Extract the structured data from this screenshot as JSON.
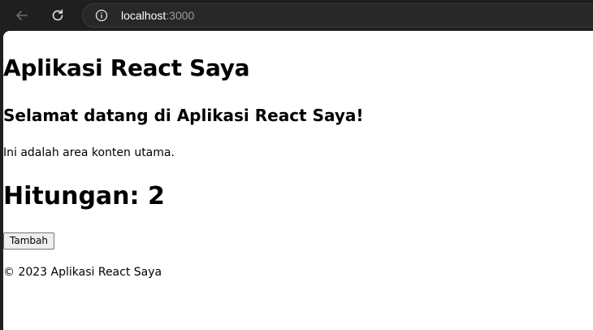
{
  "browser": {
    "url_host": "localhost",
    "url_port": ":3000",
    "back_icon": "arrow-left-icon",
    "reload_icon": "reload-icon",
    "info_icon": "info-icon"
  },
  "app": {
    "title": "Aplikasi React Saya",
    "welcome": "Selamat datang di Aplikasi React Saya!",
    "content": "Ini adalah area konten utama.",
    "counter_label": "Hitungan: 2",
    "counter_value": 2,
    "add_button": "Tambah",
    "footer": "© 2023 Aplikasi React Saya"
  }
}
